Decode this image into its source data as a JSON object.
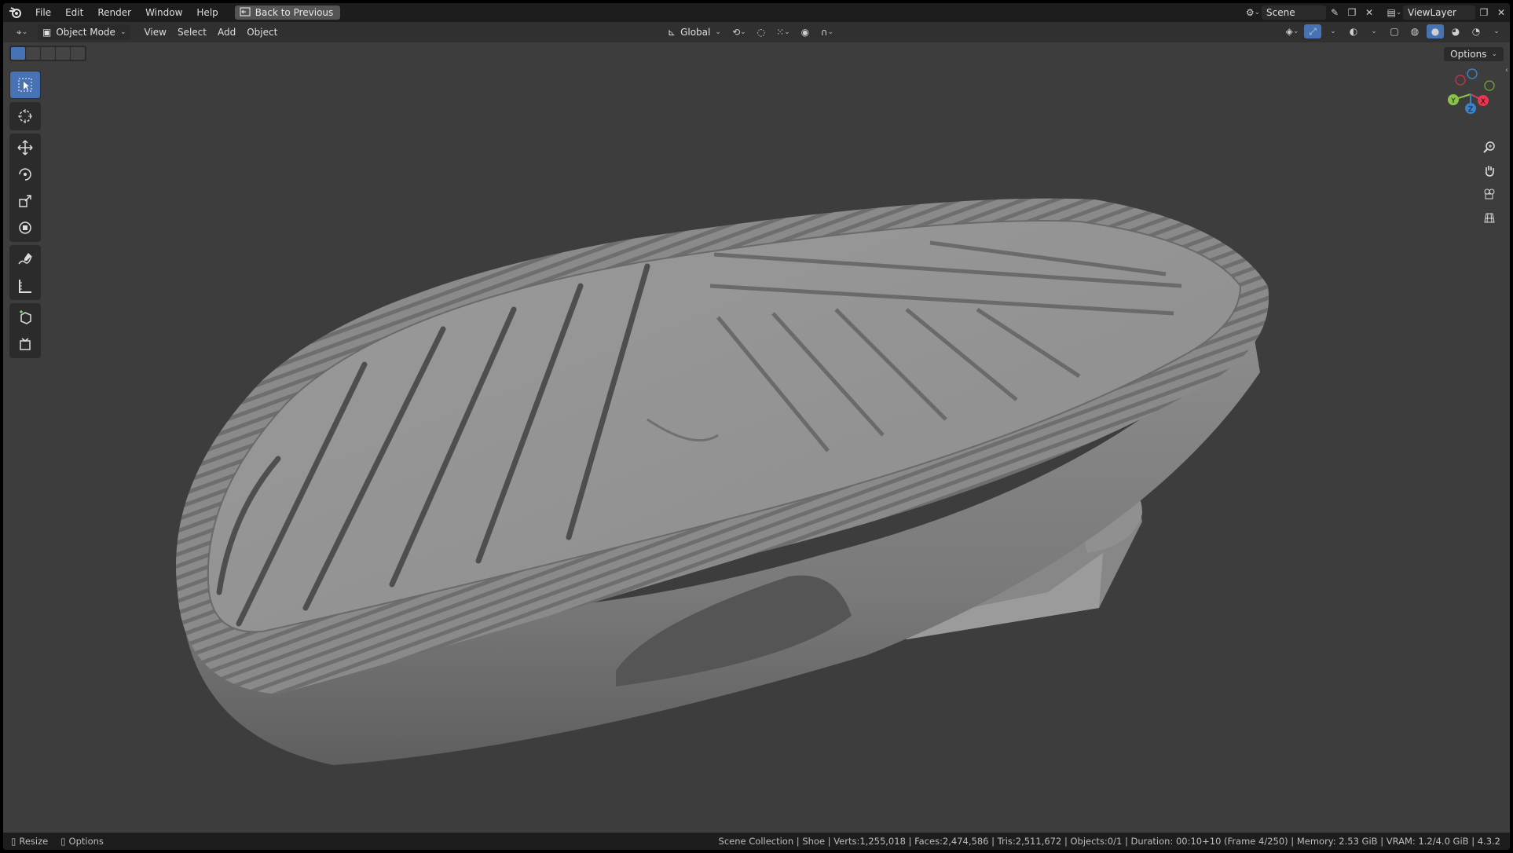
{
  "menubar": {
    "items": [
      "File",
      "Edit",
      "Render",
      "Window",
      "Help"
    ],
    "back_button": "Back to Previous",
    "scene_name": "Scene",
    "view_layer": "ViewLayer"
  },
  "header": {
    "mode": "Object Mode",
    "menus": [
      "View",
      "Select",
      "Add",
      "Object"
    ],
    "transform_orientation": "Global",
    "options": "Options"
  },
  "toolbar": {
    "tools": [
      "select-box-icon",
      "cursor-icon",
      "move-icon",
      "rotate-icon",
      "scale-icon",
      "transform-icon",
      "annotate-icon",
      "measure-icon",
      "add-cube-icon",
      "add-primitive-icon"
    ]
  },
  "navigation": {
    "axes": [
      "X",
      "Y",
      "Z"
    ],
    "tools": [
      "zoom-icon",
      "pan-hand-icon",
      "camera-icon",
      "grid-icon"
    ]
  },
  "statusbar": {
    "left_items": [
      "Resize",
      "Options"
    ],
    "stats": "Scene Collection | Shoe | Verts:1,255,018 | Faces:2,474,586 | Tris:2,511,672 | Objects:0/1 | Duration: 00:10+10 (Frame 4/250) | Memory: 2.53 GiB | VRAM: 1.2/4.0 GiB | 4.3.2"
  },
  "colors": {
    "accent": "#4772b3",
    "viewport_bg": "#3d3d3d",
    "axis_x": "#e8364f",
    "axis_y": "#8bc34a",
    "axis_z": "#3b82c4"
  }
}
